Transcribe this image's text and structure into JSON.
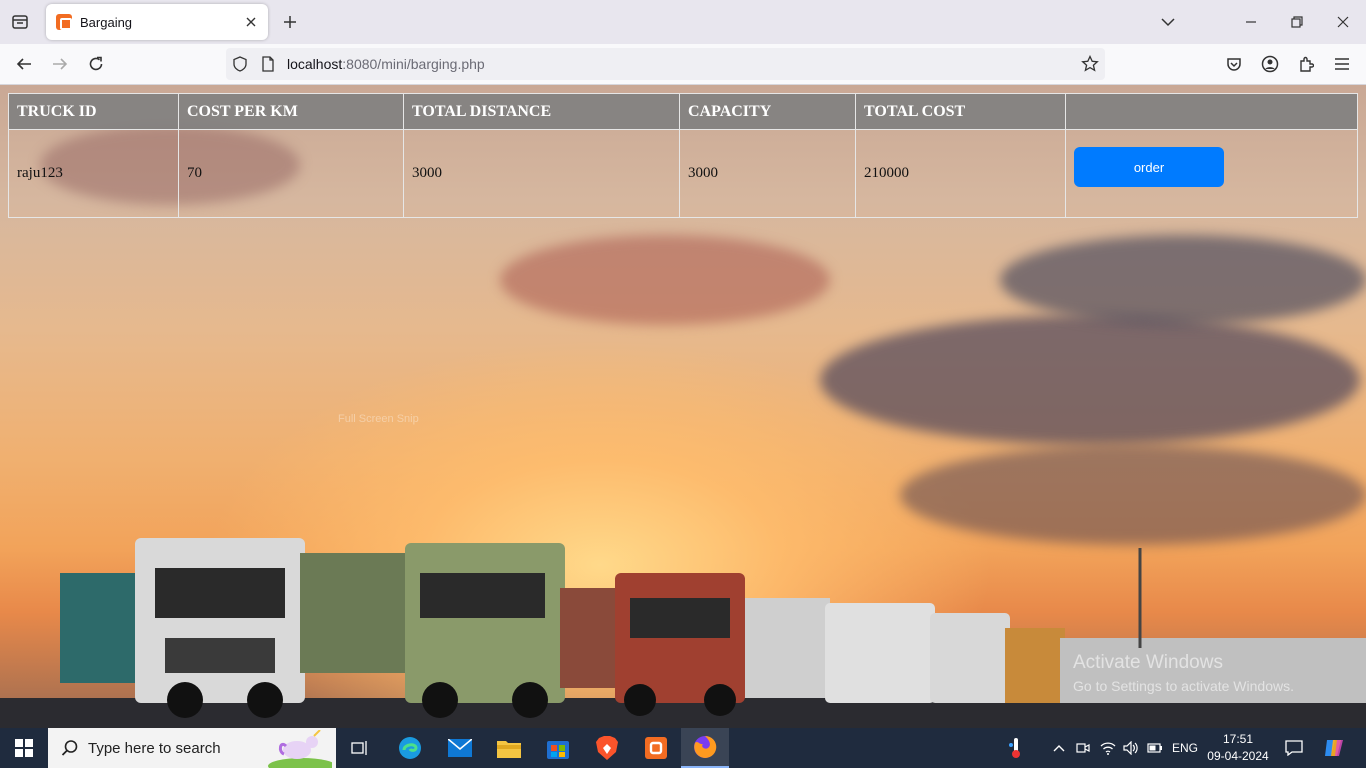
{
  "browser": {
    "tab_title": "Bargaing",
    "url_host": "localhost",
    "url_rest": ":8080/mini/barging.php"
  },
  "table": {
    "headers": [
      "TRUCK ID",
      "COST PER KM",
      "TOTAL DISTANCE",
      "CAPACITY",
      "TOTAL COST",
      ""
    ],
    "rows": [
      {
        "truck_id": "raju123",
        "cost_per_km": "70",
        "total_distance": "3000",
        "capacity": "3000",
        "total_cost": "210000",
        "action": "order"
      }
    ]
  },
  "overlay": {
    "snip_text": "Full Screen Snip",
    "activate_title": "Activate Windows",
    "activate_sub": "Go to Settings to activate Windows."
  },
  "taskbar": {
    "search_placeholder": "Type here to search",
    "language": "ENG",
    "time": "17:51",
    "date": "09-04-2024"
  },
  "colors": {
    "order_button": "#007bff",
    "header_bg": "#808080",
    "taskbar": "#1f2b3e"
  }
}
